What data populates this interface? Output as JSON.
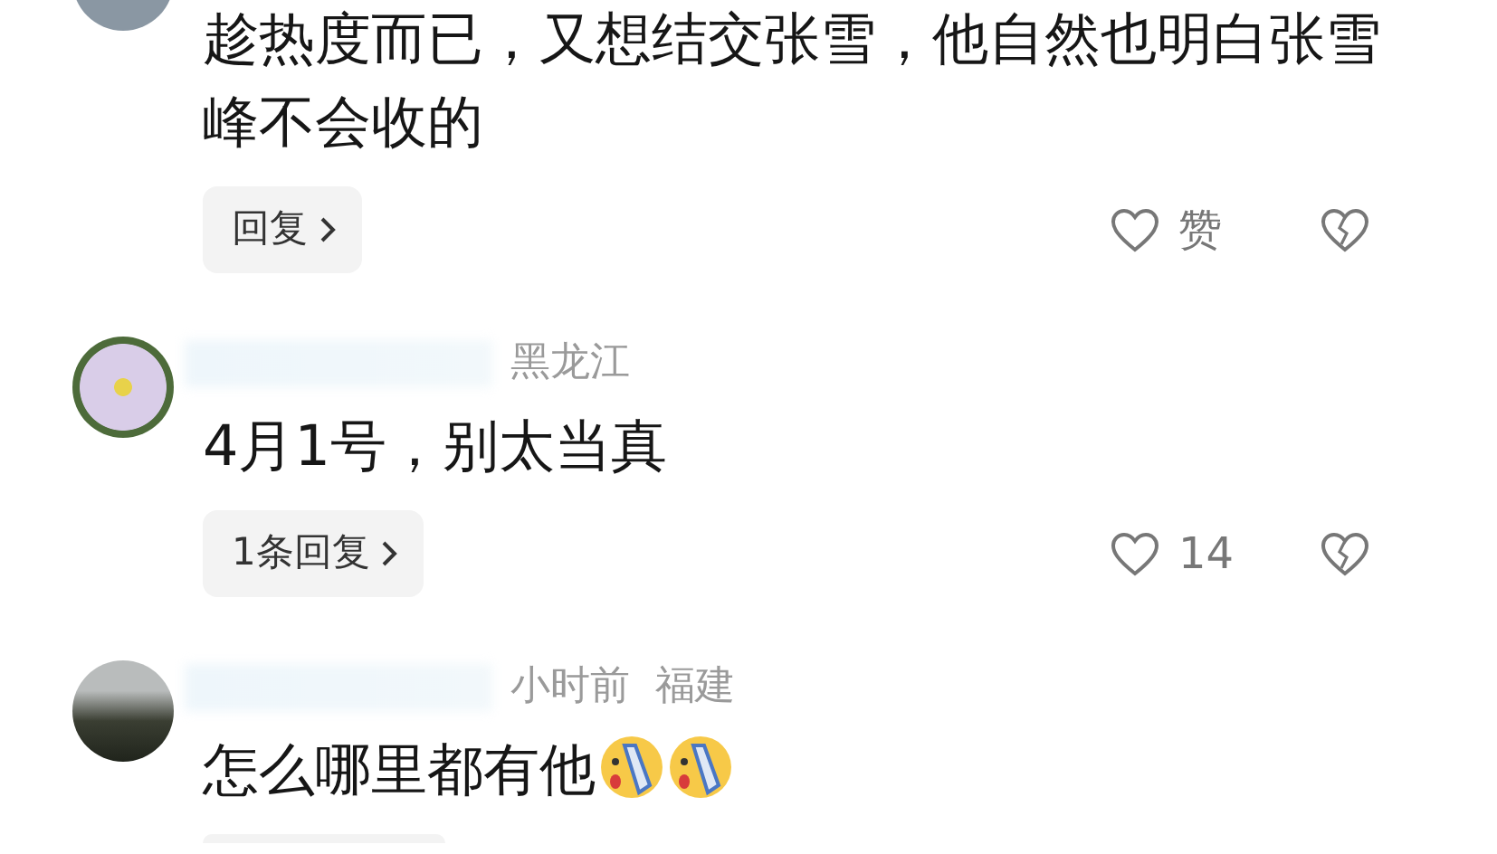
{
  "comments": [
    {
      "text": "趁热度而已，又想结交张雪，他自然也明白张雪峰不会收的",
      "reply": "回复",
      "likes": "赞"
    },
    {
      "name_blurred": true,
      "meta": [
        "黑龙江"
      ],
      "text": "4月1号，别太当真",
      "reply": "1条回复",
      "likes": "14"
    },
    {
      "name_blurred": true,
      "meta": [
        "小时前",
        "福建"
      ],
      "text": "怎么哪里都有他",
      "emojis": [
        {
          "kind": "crying"
        },
        {
          "kind": "crying"
        }
      ],
      "reply_cut": true
    }
  ]
}
